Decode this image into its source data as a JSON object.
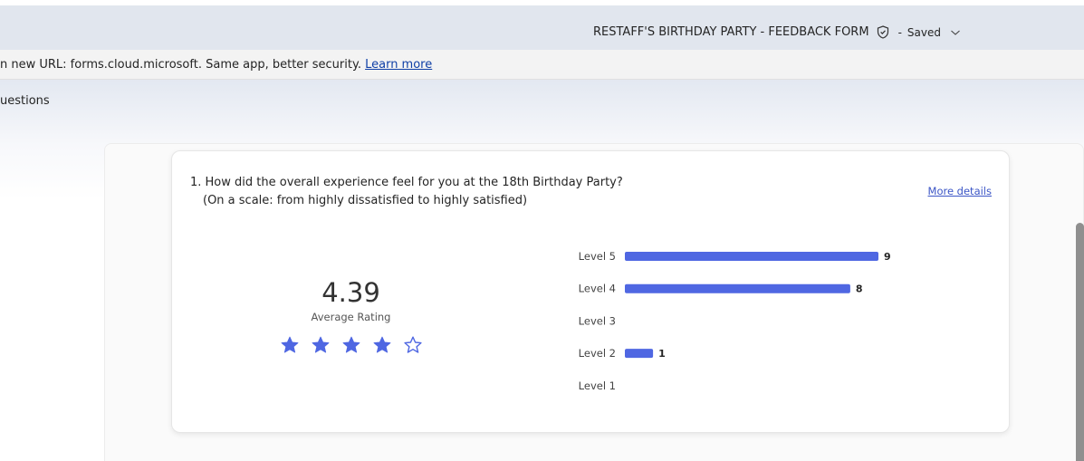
{
  "header": {
    "form_title": "RESTAFF'S BIRTHDAY PARTY - FEEDBACK FORM",
    "separator": "-",
    "save_status": "Saved"
  },
  "notice": {
    "text": "n new URL: forms.cloud.microsoft. Same app, better security.",
    "link": "Learn more"
  },
  "tabs": {
    "questions": "uestions"
  },
  "question": {
    "line1": "1. How did the overall experience feel for you at the 18th Birthday Party?",
    "line2": "(On a scale: from highly dissatisfied to highly satisfied)",
    "more_details": "More details"
  },
  "rating": {
    "value": "4.39",
    "label": "Average Rating",
    "stars_filled": 4,
    "stars_total": 5,
    "star_color": "#4f67e2"
  },
  "chart_data": {
    "type": "bar",
    "orientation": "horizontal",
    "categories": [
      "Level 5",
      "Level 4",
      "Level 3",
      "Level 2",
      "Level 1"
    ],
    "values": [
      9,
      8,
      0,
      1,
      0
    ],
    "bar_color": "#4f67e2",
    "grid": false
  }
}
